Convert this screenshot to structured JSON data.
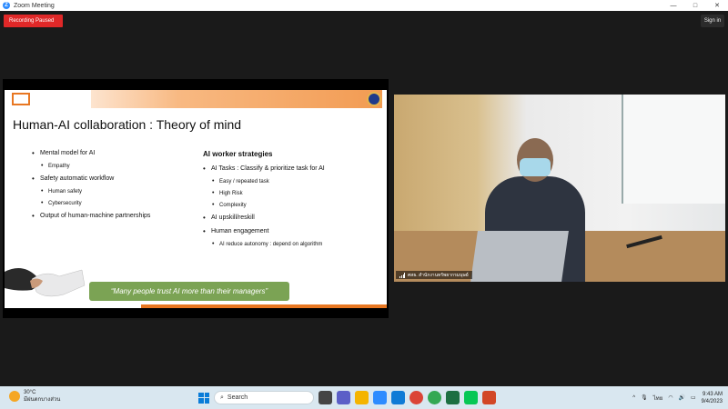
{
  "window": {
    "title": "Zoom Meeting",
    "app_logo": "Z",
    "minimize": "—",
    "maximize": "□",
    "close": "✕"
  },
  "meeting": {
    "recording_status": "Recording Paused",
    "sign_in": "Sign in"
  },
  "slide": {
    "title": "Human-AI collaboration : Theory of mind",
    "left_items": [
      {
        "label": "Mental model for AI",
        "sub": [
          "Empathy"
        ]
      },
      {
        "label": "Safety automatic workflow",
        "sub": [
          "Human safety",
          "Cybersecurity"
        ]
      },
      {
        "label": "Output of human-machine partnerships",
        "sub": []
      }
    ],
    "right_heading": "AI worker strategies",
    "right_items": [
      {
        "label": "AI Tasks : Classify & prioritize task for AI",
        "sub": [
          "Easy / repeated task",
          "High Risk",
          "Complexity"
        ]
      },
      {
        "label": "AI upskill/reskill",
        "sub": []
      },
      {
        "label": "Human engagement",
        "sub": [
          "AI reduce autonomy : depend on algorithm"
        ]
      }
    ],
    "quote": "“Many people trust AI more than their managers”"
  },
  "video": {
    "participant_name": "ศสธ. สำนักงานทรัพยากรมนุษย์"
  },
  "taskbar": {
    "weather_temp": "30°C",
    "weather_desc": "มีฝนตกบางส่วน",
    "search_placeholder": "Search",
    "language": "ไทย",
    "time": "9:43 AM",
    "date": "9/4/2023",
    "pinned_apps": [
      {
        "name": "task-view",
        "color": "#444444"
      },
      {
        "name": "chat",
        "color": "#5b5fc7"
      },
      {
        "name": "file-explorer",
        "color": "#f4b400"
      },
      {
        "name": "zoom",
        "color": "#2d8cff"
      },
      {
        "name": "edge",
        "color": "#0f7bd6"
      },
      {
        "name": "chrome",
        "color": "#db4437"
      },
      {
        "name": "chrome-alt",
        "color": "#34a853"
      },
      {
        "name": "excel",
        "color": "#1d6f42"
      },
      {
        "name": "line",
        "color": "#06c755"
      },
      {
        "name": "powerpoint",
        "color": "#d24726"
      }
    ]
  }
}
